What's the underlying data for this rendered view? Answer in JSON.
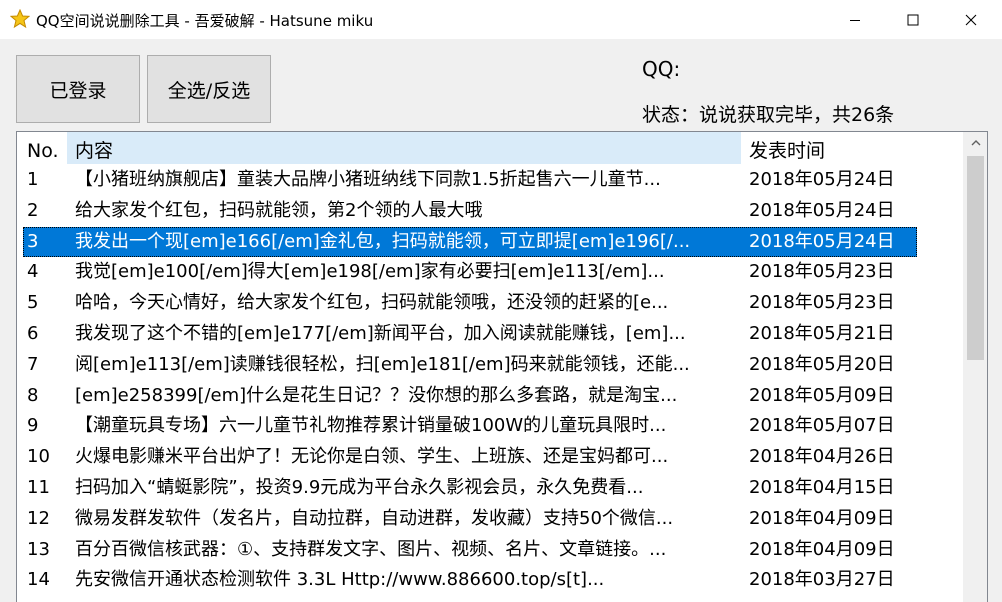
{
  "window": {
    "title": "QQ空间说说删除工具 - 吾爱破解 - Hatsune miku",
    "icon": "star-icon",
    "accent": "#0078d7"
  },
  "toolbar": {
    "login_label": "已登录",
    "select_label": "全选/反选"
  },
  "info": {
    "qq_label": "QQ:",
    "status_text": "状态：说说获取完毕，共26条"
  },
  "list": {
    "columns": [
      "No.",
      "内容",
      "发表时间"
    ],
    "rows": [
      {
        "no": "1",
        "content": "【小猪班纳旗舰店】童装大品牌小猪班纳线下同款1.5折起售六一儿童节...",
        "time": "2018年05月24日"
      },
      {
        "no": "2",
        "content": "给大家发个红包，扫码就能领，第2个领的人最大哦",
        "time": "2018年05月24日"
      },
      {
        "no": "3",
        "content": "我发出一个现[em]e166[/em]金礼包，扫码就能领，可立即提[em]e196[/...",
        "time": "2018年05月24日"
      },
      {
        "no": "4",
        "content": "我觉[em]e100[/em]得大[em]e198[/em]家有必要扫[em]e113[/em]...",
        "time": "2018年05月23日"
      },
      {
        "no": "5",
        "content": "哈哈，今天心情好，给大家发个红包，扫码就能领哦，还没领的赶紧的[e...",
        "time": "2018年05月23日"
      },
      {
        "no": "6",
        "content": "我发现了这个不错的[em]e177[/em]新闻平台，加入阅读就能赚钱，[em]...",
        "time": "2018年05月21日"
      },
      {
        "no": "7",
        "content": "阅[em]e113[/em]读赚钱很轻松，扫[em]e181[/em]码来就能领钱，还能...",
        "time": "2018年05月20日"
      },
      {
        "no": "8",
        "content": "[em]e258399[/em]什么是花生日记？？没你想的那么多套路，就是淘宝...",
        "time": "2018年05月09日"
      },
      {
        "no": "9",
        "content": "【潮童玩具专场】六一儿童节礼物推荐累计销量破100W的儿童玩具限时...",
        "time": "2018年05月07日"
      },
      {
        "no": "10",
        "content": "火爆电影赚米平台出炉了！无论你是白领、学生、上班族、还是宝妈都可...",
        "time": "2018年04月26日"
      },
      {
        "no": "11",
        "content": "扫码加入“蜻蜓影院”，投资9.9元成为平台永久影视会员，永久免费看...",
        "time": "2018年04月15日"
      },
      {
        "no": "12",
        "content": "微易发群发软件（发名片，自动拉群，自动进群，发收藏）支持50个微信...",
        "time": "2018年04月09日"
      },
      {
        "no": "13",
        "content": "百分百微信核武器：①、支持群发文字、图片、视频、名片、文章链接。...",
        "time": "2018年04月09日"
      },
      {
        "no": "14",
        "content": "先安微信开通状态检测软件 3.3L Http://www.886600.top/s[t]...",
        "time": "2018年03月27日"
      }
    ],
    "selected_index": 2
  }
}
